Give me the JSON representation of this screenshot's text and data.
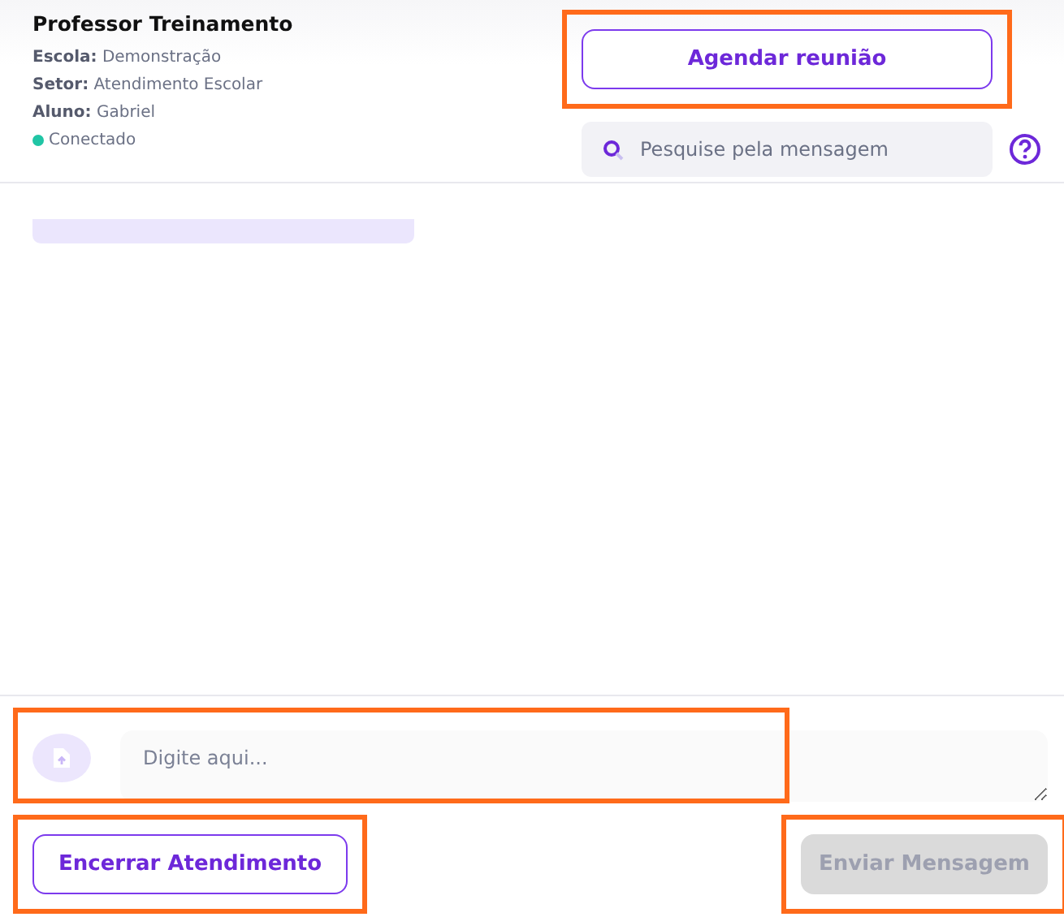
{
  "contact": {
    "name": "Professor Treinamento",
    "fields": [
      {
        "label": "Escola:",
        "value": "Demonstração"
      },
      {
        "label": "Setor:",
        "value": "Atendimento Escolar"
      },
      {
        "label": "Aluno:",
        "value": "Gabriel"
      }
    ],
    "status": {
      "text": "Conectado",
      "color": "#20c5a5"
    }
  },
  "schedule_button": {
    "label": "Agendar reunião",
    "highlighted": true
  },
  "search": {
    "placeholder": "Pesquise pela mensagem"
  },
  "messages": [
    {
      "kind": "placeholder"
    }
  ],
  "composer": {
    "placeholder": "Digite aqui...",
    "highlighted": true
  },
  "end_button": {
    "label": "Encerrar Atendimento",
    "highlighted": true
  },
  "send_button": {
    "label": "Enviar Mensagem",
    "disabled": true,
    "highlighted": true
  }
}
